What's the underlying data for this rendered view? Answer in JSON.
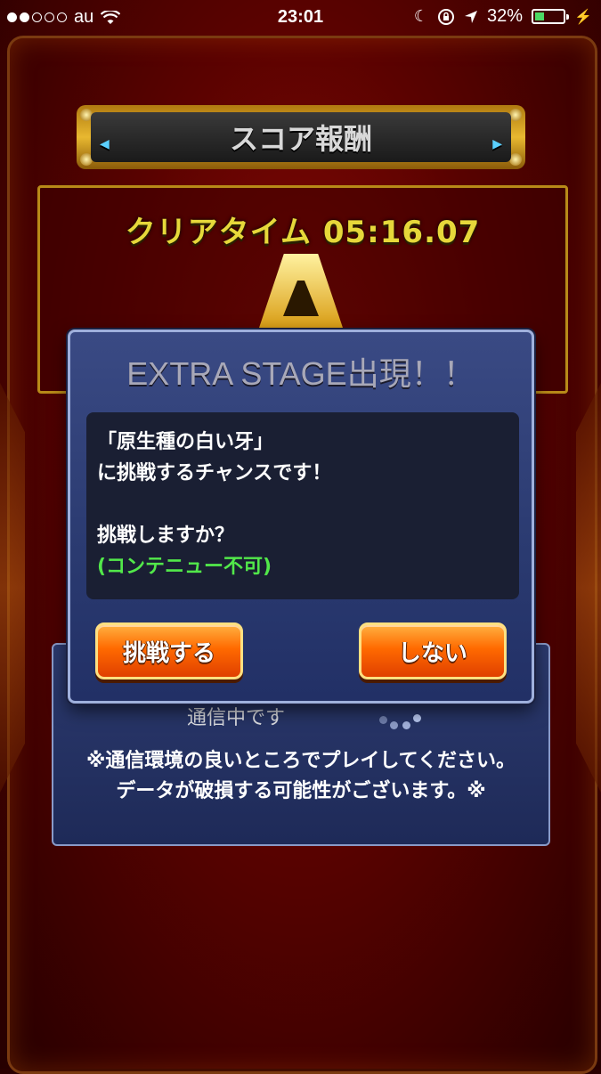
{
  "status_bar": {
    "carrier": "au",
    "time": "23:01",
    "battery": "32%",
    "battery_level": 0.32
  },
  "score_header": {
    "title": "スコア報酬"
  },
  "score": {
    "clear_time": "クリアタイム 05:16.07",
    "rank": "A"
  },
  "dialog": {
    "title": "EXTRA STAGE出現！！",
    "line1": "「原生種の白い牙」",
    "line2": "に挑戦するチャンスです！",
    "line3": "挑戦しますか？",
    "line4": "(コンテニュー不可)",
    "yes_label": "挑戦する",
    "no_label": "しない"
  },
  "comm_panel": {
    "partial_text": "通信中です",
    "notice_line1": "※通信環境の良いところでプレイしてください。",
    "notice_line2": "データが破損する可能性がございます。※"
  }
}
